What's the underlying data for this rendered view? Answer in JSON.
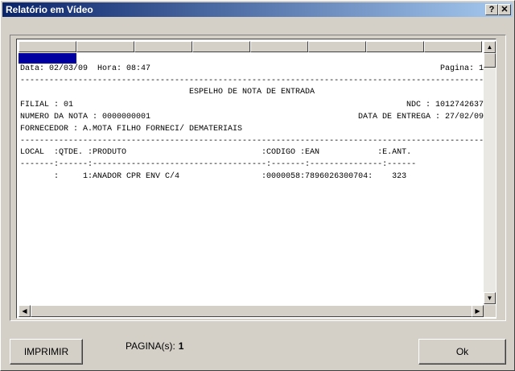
{
  "window": {
    "title": "Relatório em Vídeo",
    "help_glyph": "?",
    "close_glyph": "✕"
  },
  "report": {
    "date_line": "Data: 02/03/09  Hora: 08:47",
    "page_line": "Pagina: 1",
    "separator": "------------------------------------------------------------------------------------------------",
    "heading": "ESPELHO DE NOTA DE ENTRADA",
    "filial": "FILIAL : 01",
    "ndc": "NDC : 1012742637",
    "numero_nota": "NUMERO DA NOTA : 0000000001",
    "data_entrega": "DATA DE ENTREGA : 27/02/09",
    "fornecedor": "FORNECEDOR : A.MOTA FILHO FORNECI/ DEMATERIAIS",
    "column_header": "LOCAL  :QTDE. :PRODUTO                            :CODIGO :EAN            :E.ANT.",
    "column_rule": "-------:------:------------------------------------:-------:---------------:------",
    "rows": [
      "       :     1:ANADOR CPR ENV C/4                 :0000058:7896026300704:    323"
    ]
  },
  "footer": {
    "print_label": "IMPRIMIR",
    "pages_label": "PAGINA(s):",
    "pages_value": "1",
    "ok_label": "Ok"
  }
}
